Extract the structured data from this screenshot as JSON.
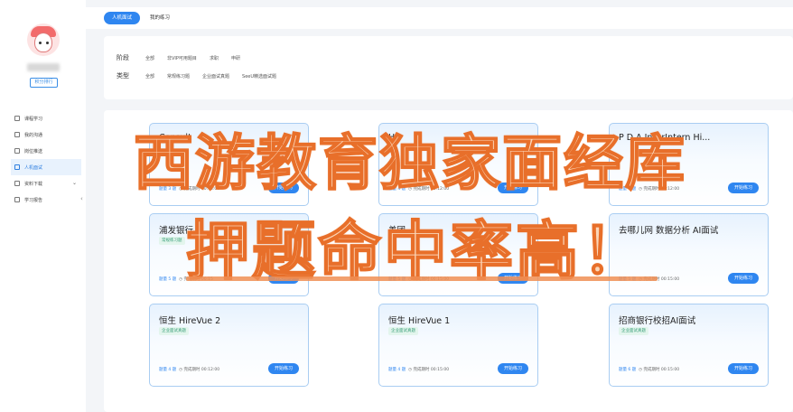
{
  "sidebar": {
    "rank_label": "积分排行",
    "items": [
      {
        "label": "课程学习",
        "icon": "book-icon"
      },
      {
        "label": "我的沟通",
        "icon": "chat-icon"
      },
      {
        "label": "岗位推送",
        "icon": "briefcase-icon"
      },
      {
        "label": "人机面试",
        "icon": "robot-icon"
      },
      {
        "label": "资料下载",
        "icon": "download-icon"
      },
      {
        "label": "学习报告",
        "icon": "report-icon"
      }
    ],
    "active_index": 3
  },
  "tabs": [
    {
      "label": "人机面试"
    },
    {
      "label": "我的练习"
    }
  ],
  "filters": {
    "stage_label": "阶段",
    "stage_options": [
      "全部",
      "非VIP可用题目",
      "求职",
      "申研"
    ],
    "type_label": "类型",
    "type_options": [
      "全部",
      "常规练习题",
      "企业面试真题",
      "SeeU精选面试题"
    ]
  },
  "cards": [
    {
      "title": "Consult",
      "tag": "",
      "questions": "题量 3 题",
      "duration": "完成期时 00:15:00",
      "button": "开始练习"
    },
    {
      "title": "H",
      "tag": "",
      "questions": "题量 4 题",
      "duration": "完成期时 00:12:00",
      "button": "开始练习"
    },
    {
      "title": "P   D A   In   r   rIntern Hi...",
      "tag": "",
      "questions": "题量 4 题",
      "duration": "完成期时 00:12:00",
      "button": "开始练习"
    },
    {
      "title": "浦发银行",
      "tag": "常规练习题",
      "questions": "题量 5 题",
      "duration": "完成期时 00:15",
      "button": "开始练习"
    },
    {
      "title": "美团",
      "tag": "",
      "questions": "题量 5 题",
      "duration": "完成期时 00:15:00",
      "button": "开始练习"
    },
    {
      "title": "去哪儿网 数据分析 AI面试",
      "tag": "",
      "questions": "题量 5 题",
      "duration": "完成期时 00:15:00",
      "button": "开始练习"
    },
    {
      "title": "恒生 HireVue 2",
      "tag": "企业面试真题",
      "questions": "题量 4 题",
      "duration": "完成期时 00:12:00",
      "button": "开始练习"
    },
    {
      "title": "恒生 HireVue 1",
      "tag": "企业面试真题",
      "questions": "题量 4 题",
      "duration": "完成期时 00:15:00",
      "button": "开始练习"
    },
    {
      "title": "招商银行校招AI面试",
      "tag": "企业面试真题",
      "questions": "题量 6 题",
      "duration": "完成期时 00:15:00",
      "button": "开始练习"
    }
  ],
  "overlay": {
    "line1": "西游教育独家面经库",
    "line2": "押题命中率高！"
  }
}
